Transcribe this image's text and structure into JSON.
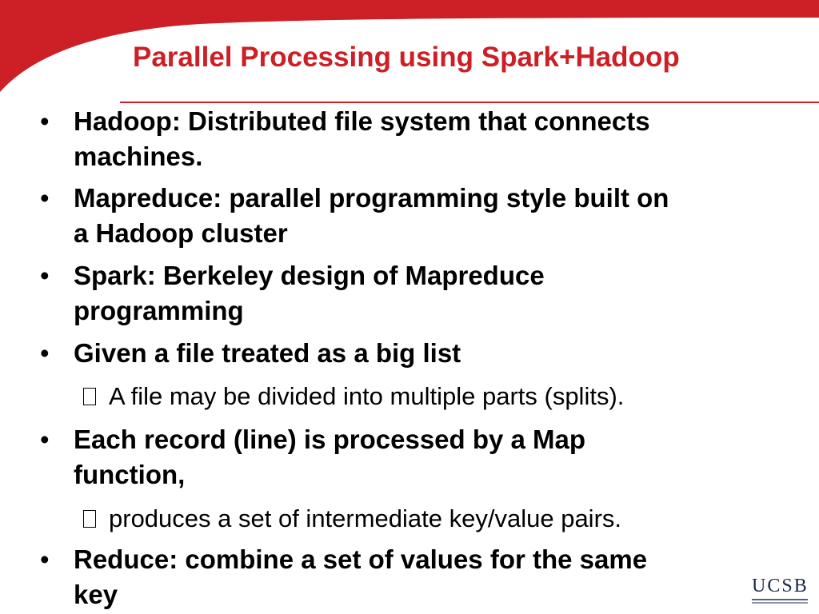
{
  "slide": {
    "title": "Parallel Processing using Spark+Hadoop",
    "bullets": [
      {
        "lines": [
          "Hadoop:  Distributed file system that connects",
          "machines."
        ]
      },
      {
        "lines": [
          "Mapreduce: parallel programming style built on",
          "a Hadoop cluster"
        ]
      },
      {
        "lines": [
          "Spark: Berkeley design of Mapreduce",
          "programming"
        ]
      },
      {
        "lines": [
          "Given a file  treated as a big list"
        ]
      },
      {
        "lines": [
          "Each record (line) is processed by a Map",
          "function,"
        ]
      },
      {
        "lines": [
          "Reduce:   combine a set of values for the same",
          "key"
        ]
      }
    ],
    "subbullets": [
      "A file may be divided into multiple parts (splits).",
      "produces a set of intermediate key/value pairs."
    ],
    "bullet_symbol": "•",
    "logo_text": "UCSB",
    "colors": {
      "accent": "#cc1f26",
      "text": "#000000"
    }
  }
}
